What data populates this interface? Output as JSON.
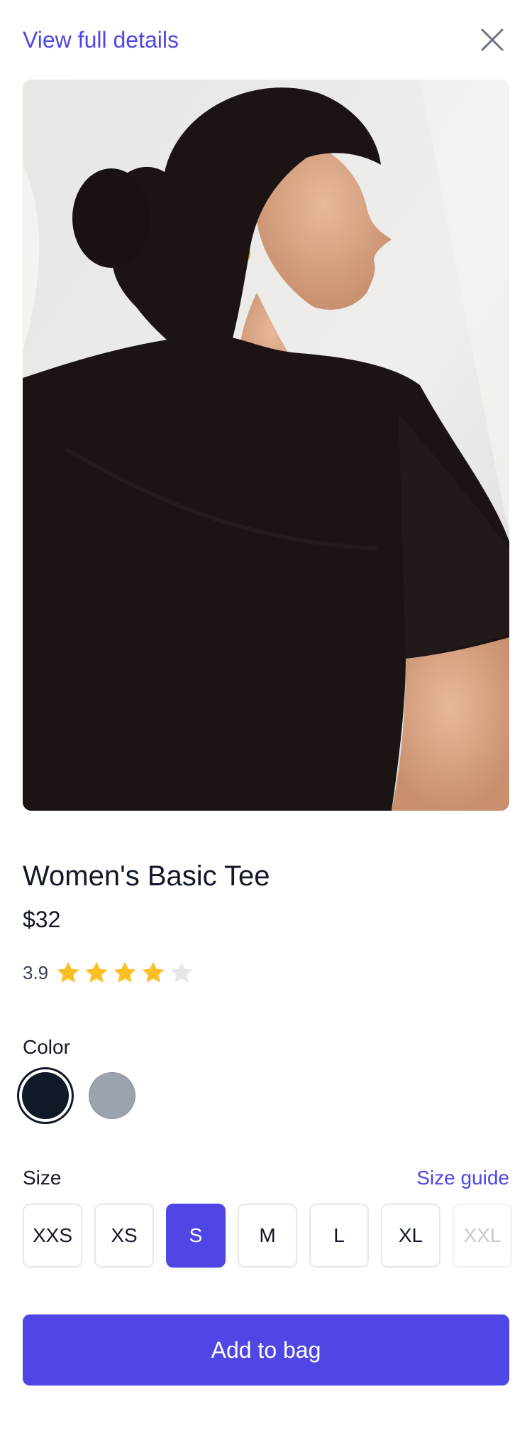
{
  "header": {
    "link_label": "View full details",
    "close_icon": "close-icon"
  },
  "product": {
    "image_icon": "product-photo",
    "name": "Women's Basic Tee",
    "price": "$32",
    "rating": {
      "value": "3.9",
      "stars_filled": 4,
      "stars_total": 5,
      "filled_color": "#fbbf24",
      "empty_color": "#e5e7eb"
    }
  },
  "color": {
    "label": "Color",
    "options": [
      {
        "name": "Black",
        "hex": "#111827",
        "selected": true
      },
      {
        "name": "Gray",
        "hex": "#9ca3af",
        "selected": false
      }
    ]
  },
  "size": {
    "label": "Size",
    "guide_label": "Size guide",
    "options": [
      {
        "label": "XXS",
        "state": "available"
      },
      {
        "label": "XS",
        "state": "available"
      },
      {
        "label": "S",
        "state": "selected"
      },
      {
        "label": "M",
        "state": "available"
      },
      {
        "label": "L",
        "state": "available"
      },
      {
        "label": "XL",
        "state": "available"
      },
      {
        "label": "XXL",
        "state": "disabled"
      }
    ]
  },
  "cta": {
    "add_label": "Add to bag"
  },
  "theme": {
    "accent": "#4f46e5",
    "text": "#111827"
  }
}
